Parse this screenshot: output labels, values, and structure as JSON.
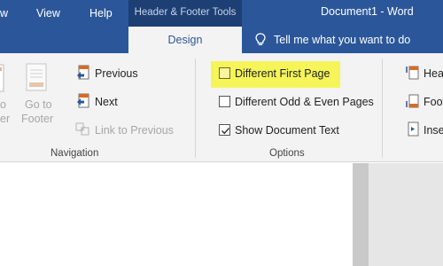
{
  "titlebar": {
    "context_header": "Header & Footer Tools",
    "document_title": "Document1  -  Word"
  },
  "tabs": {
    "view_partial": "w",
    "view": "View",
    "help": "Help",
    "design": "Design",
    "tell_me": "Tell me what you want to do"
  },
  "navigation": {
    "left_partial_1": "o",
    "left_partial_2": "er",
    "go_to_footer_line1": "Go to",
    "go_to_footer_line2": "Footer",
    "previous": "Previous",
    "next": "Next",
    "link_to_previous": "Link to Previous",
    "group_label": "Navigation"
  },
  "options": {
    "different_first_page": "Different First Page",
    "different_first_page_checked": false,
    "different_odd_even": "Different Odd & Even Pages",
    "different_odd_even_checked": false,
    "show_document_text": "Show Document Text",
    "show_document_text_checked": true,
    "group_label": "Options"
  },
  "position": {
    "header_partial": "Hea",
    "footer_partial": "Foot",
    "insert_partial": "Inse"
  },
  "colors": {
    "word_blue": "#2b579a",
    "context_dark": "#1e3f73",
    "ribbon_bg": "#f3f3f3",
    "highlight": "#f5f55a",
    "icon_orange": "#d86b26"
  }
}
